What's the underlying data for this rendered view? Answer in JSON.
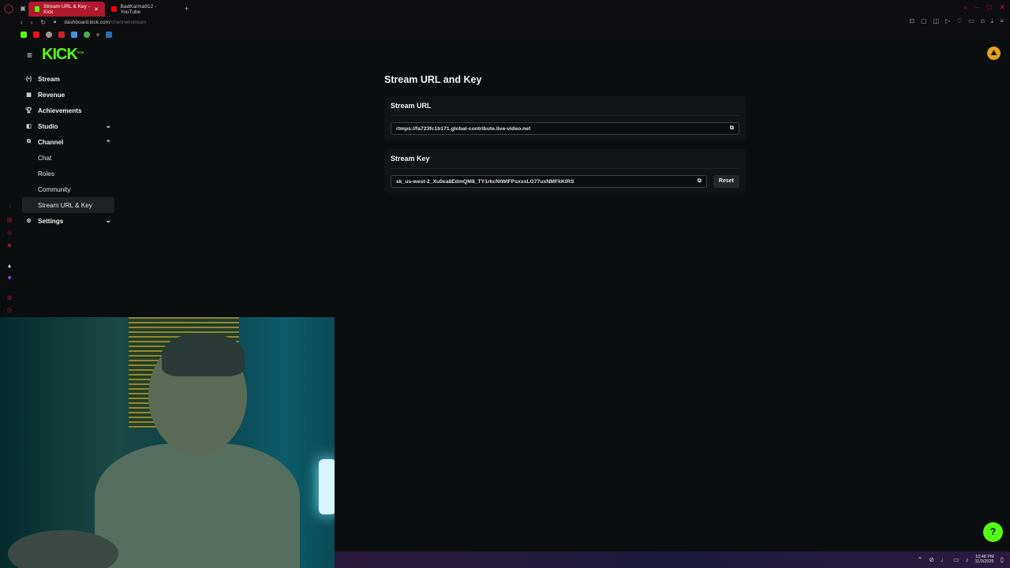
{
  "browser": {
    "tabs": [
      {
        "title": "Stream URL & Key - Kick",
        "active": true,
        "color": "#53fc18"
      },
      {
        "title": "BadKarma912 - YouTube",
        "active": false,
        "color": "#ff0000"
      }
    ],
    "url_host": "dashboard.kick.com",
    "url_path": "/channel/stream",
    "new_tab_label": "+"
  },
  "header": {
    "logo": "KICK",
    "logo_sup": "beta"
  },
  "sidebar": {
    "items": [
      {
        "label": "Stream",
        "icon": "broadcast-icon"
      },
      {
        "label": "Revenue",
        "icon": "revenue-icon"
      },
      {
        "label": "Achievements",
        "icon": "trophy-icon"
      },
      {
        "label": "Studio",
        "icon": "studio-icon"
      },
      {
        "label": "Channel",
        "icon": "channel-icon"
      },
      {
        "label": "Chat"
      },
      {
        "label": "Roles"
      },
      {
        "label": "Community"
      },
      {
        "label": "Stream URL & Key"
      },
      {
        "label": "Settings",
        "icon": "gear-icon"
      }
    ]
  },
  "main": {
    "title": "Stream URL and Key",
    "stream_url": {
      "title": "Stream URL",
      "value": "rtmps://fa723fc1b171.global-contribute.live-video.net"
    },
    "stream_key": {
      "title": "Stream Key",
      "value": "sk_us-west-2_Xu0ea8EdmQM8_TY1rkcNtWIFPsxxxLG77uxNMFkKtRS",
      "reset_label": "Reset"
    }
  },
  "taskbar": {
    "time": "10:48 PM",
    "date": "11/3/2025"
  },
  "colors": {
    "brand": "#53fc18",
    "background": "#0b0e0f",
    "card": "#111416",
    "opera_red": "#b0182b"
  }
}
